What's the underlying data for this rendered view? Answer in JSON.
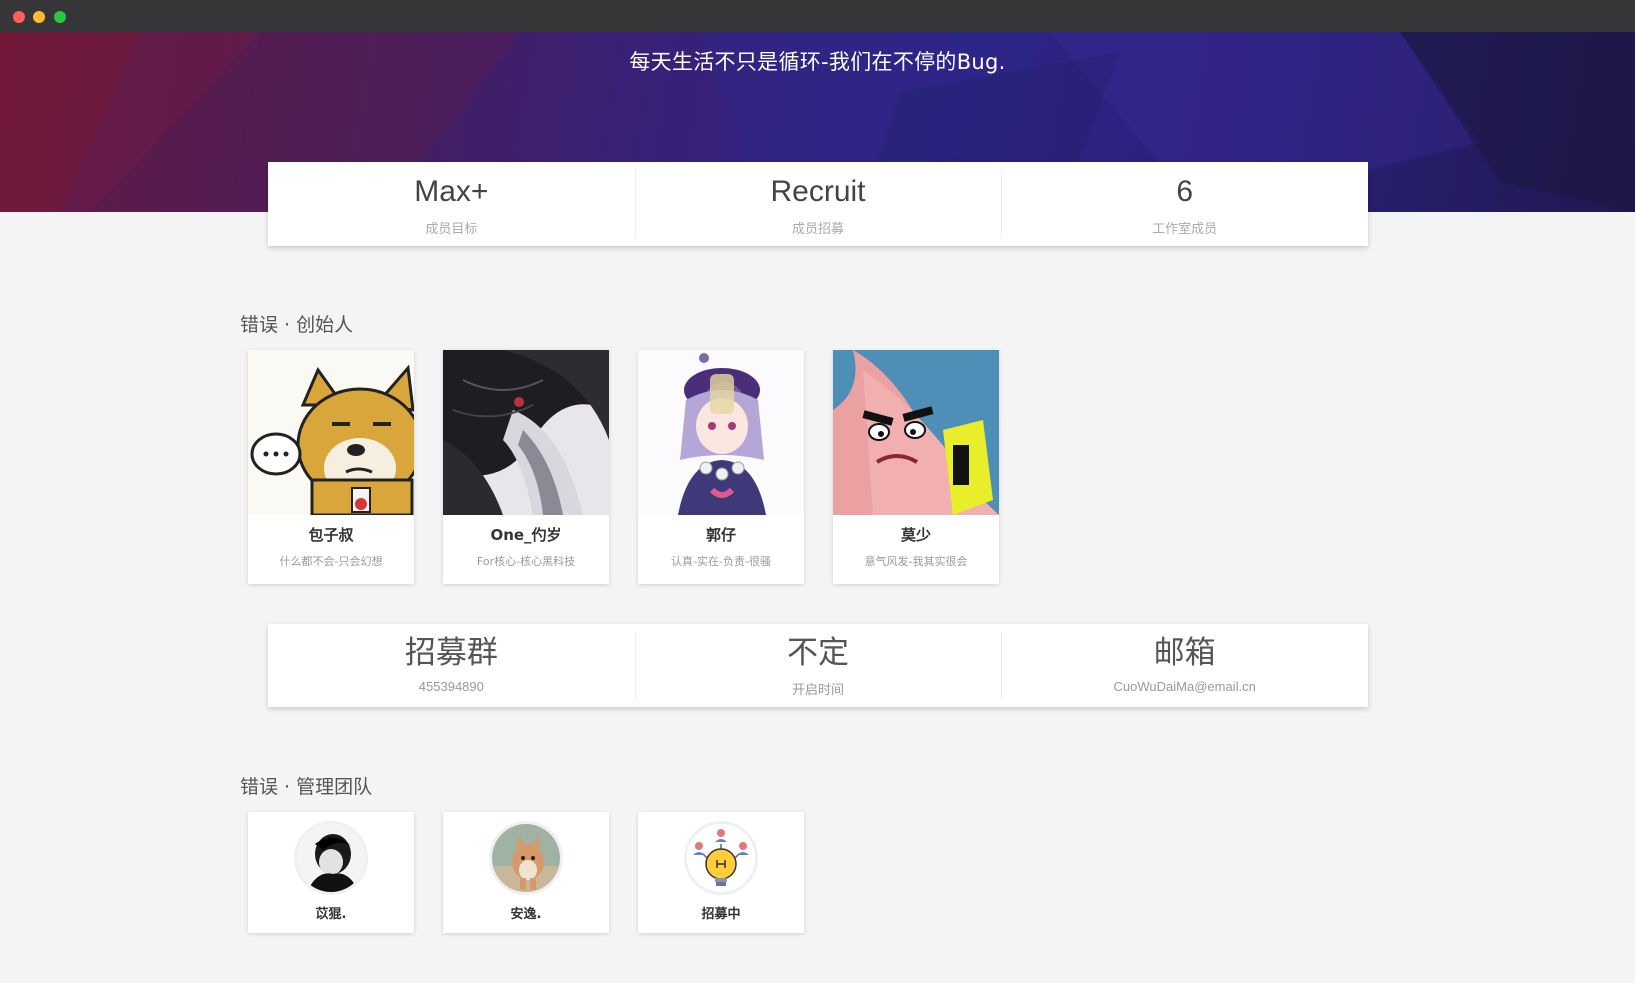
{
  "hero": {
    "title": "每天生活不只是循环-我们在不停的Bug."
  },
  "stats_top": [
    {
      "value": "Max+",
      "label": "成员目标"
    },
    {
      "value": "Recruit",
      "label": "成员招募"
    },
    {
      "value": "6",
      "label": "工作室成员"
    }
  ],
  "founders": {
    "title": "错误 · 创始人",
    "members": [
      {
        "name": "包子叔",
        "desc": "什么都不会-只会幻想",
        "icon": "shiba-dog-avatar"
      },
      {
        "name": "One_仢岁",
        "desc": "For核心-核心黑科技",
        "icon": "anime-dark-hair-avatar"
      },
      {
        "name": "郭仔",
        "desc": "认真-实在-负责-很骚",
        "icon": "anime-girl-avatar"
      },
      {
        "name": "莫少",
        "desc": "意气风发-我其实很会",
        "icon": "patrick-star-avatar"
      }
    ]
  },
  "stats_bottom": [
    {
      "value": "招募群",
      "label": "455394890"
    },
    {
      "value": "不定",
      "label": "开启时间"
    },
    {
      "value": "邮箱",
      "label": "CuoWuDaiMa@email.cn"
    }
  ],
  "management": {
    "title": "错误 · 管理团队",
    "members": [
      {
        "name": "苡猑.",
        "icon": "monochrome-person-avatar"
      },
      {
        "name": "安逸.",
        "icon": "corgi-dog-avatar"
      },
      {
        "name": "招募中",
        "icon": "lightbulb-team-icon"
      }
    ]
  },
  "colors": {
    "hero_start": "#6a1636",
    "hero_mid": "#3a2076",
    "hero_end": "#201850",
    "page_bg": "#f4f4f4"
  }
}
